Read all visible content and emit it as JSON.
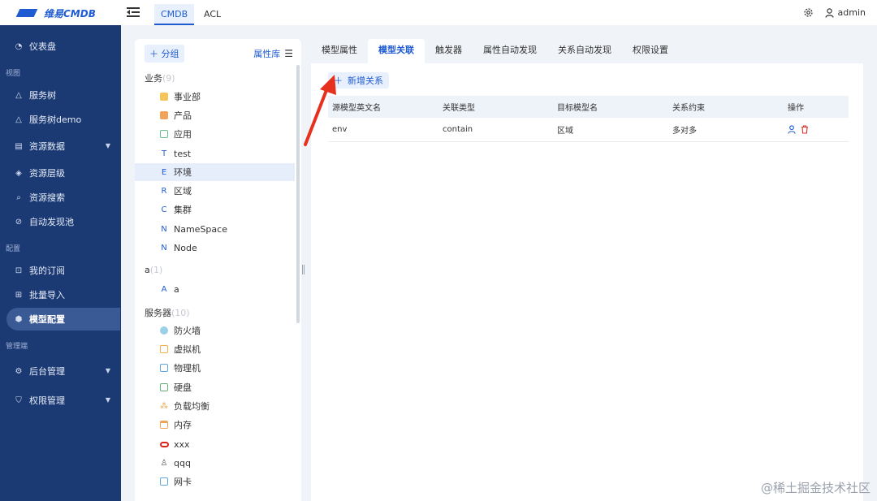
{
  "app": {
    "logo_text": "维易CMDB"
  },
  "top_tabs": [
    {
      "label": "CMDB",
      "active": true
    },
    {
      "label": "ACL",
      "active": false
    }
  ],
  "user": {
    "name": "admin"
  },
  "sidebar": {
    "items": [
      {
        "label": "仪表盘",
        "icon": "dashboard-icon"
      },
      {
        "section": "视图"
      },
      {
        "label": "服务树",
        "icon": "tree-icon"
      },
      {
        "label": "服务树demo",
        "icon": "tree-icon"
      },
      {
        "label": "资源数据",
        "icon": "table-icon",
        "expandable": true
      },
      {
        "label": "资源层级",
        "icon": "layers-icon"
      },
      {
        "label": "资源搜索",
        "icon": "search-icon"
      },
      {
        "label": "自动发现池",
        "icon": "discover-icon"
      },
      {
        "section": "配置"
      },
      {
        "label": "我的订阅",
        "icon": "bookmark-icon"
      },
      {
        "label": "批量导入",
        "icon": "import-icon"
      },
      {
        "label": "模型配置",
        "icon": "model-icon",
        "active": true
      },
      {
        "section": "管理端"
      },
      {
        "label": "后台管理",
        "icon": "gear-icon",
        "expandable": true
      },
      {
        "label": "权限管理",
        "icon": "shield-icon",
        "expandable": true
      }
    ]
  },
  "tree": {
    "add_group_label": "分组",
    "library_label": "属性库",
    "groups": [
      {
        "name": "业务",
        "count": "(9)"
      },
      {
        "name": "a",
        "count": "(1)"
      },
      {
        "name": "服务器",
        "count": "(10)"
      }
    ],
    "items": [
      {
        "label": "事业部",
        "icon": "yellow-box"
      },
      {
        "label": "产品",
        "icon": "orange-box"
      },
      {
        "label": "应用",
        "icon": "app-box"
      },
      {
        "label": "test",
        "icon": "T"
      },
      {
        "label": "环境",
        "icon": "E",
        "active": true
      },
      {
        "label": "区域",
        "icon": "R"
      },
      {
        "label": "集群",
        "icon": "C"
      },
      {
        "label": "NameSpace",
        "icon": "N"
      },
      {
        "label": "Node",
        "icon": "N"
      },
      {
        "label": "a",
        "icon": "A"
      },
      {
        "label": "防火墙",
        "icon": "firewall"
      },
      {
        "label": "虚拟机",
        "icon": "vm"
      },
      {
        "label": "物理机",
        "icon": "server"
      },
      {
        "label": "硬盘",
        "icon": "disk"
      },
      {
        "label": "负载均衡",
        "icon": "lb"
      },
      {
        "label": "内存",
        "icon": "memory"
      },
      {
        "label": "xxx",
        "icon": "oracle"
      },
      {
        "label": "qqq",
        "icon": "linux"
      },
      {
        "label": "网卡",
        "icon": "nic"
      }
    ]
  },
  "main": {
    "tabs": [
      {
        "label": "模型属性",
        "active": false
      },
      {
        "label": "模型关联",
        "active": true
      },
      {
        "label": "触发器",
        "active": false
      },
      {
        "label": "属性自动发现",
        "active": false
      },
      {
        "label": "关系自动发现",
        "active": false
      },
      {
        "label": "权限设置",
        "active": false
      }
    ],
    "add_relation_label": "新增关系",
    "columns": [
      "源模型英文名",
      "关联类型",
      "目标模型名",
      "关系约束",
      "操作"
    ],
    "rows": [
      {
        "source": "env",
        "type": "contain",
        "target": "区域",
        "constraint": "多对多"
      }
    ]
  },
  "colors": {
    "primary": "#1f5cd1",
    "sidebar": "#1b3a74",
    "annotation": "#e5311d"
  },
  "watermark": "@稀土掘金技术社区"
}
